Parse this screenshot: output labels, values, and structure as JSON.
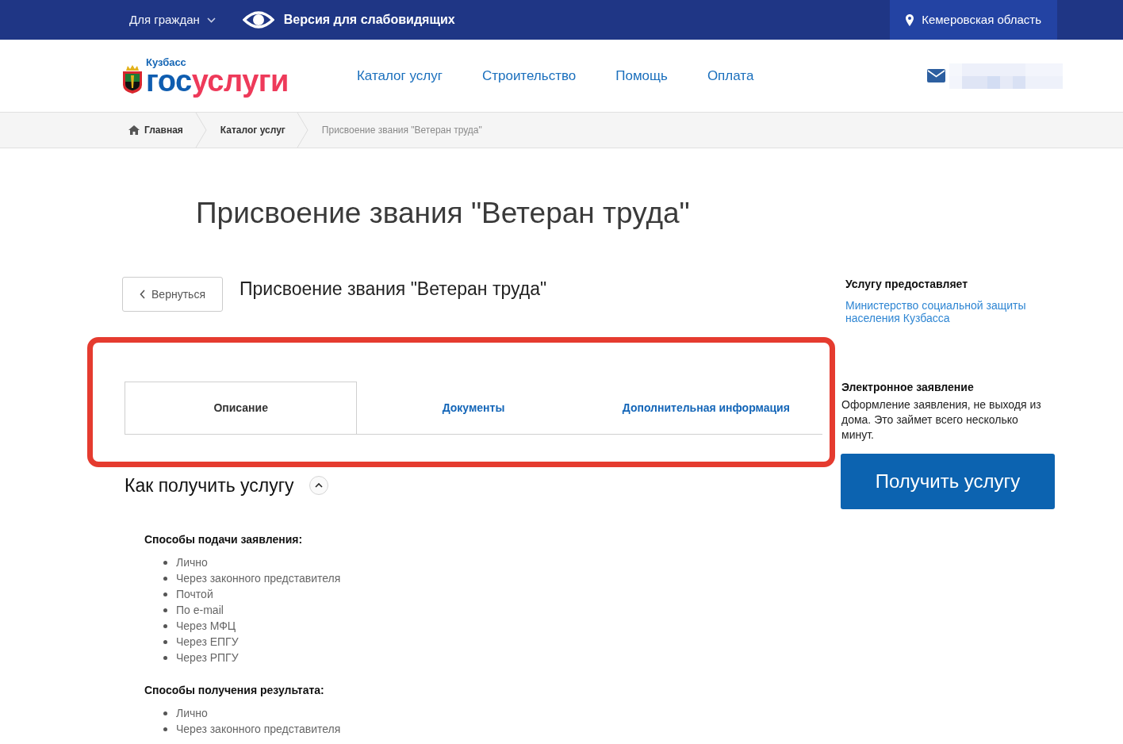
{
  "top_bar": {
    "audience_menu": "Для граждан",
    "accessibility_link": "Версия для слабовидящих",
    "region": "Кемеровская область"
  },
  "header": {
    "logo": {
      "caption": "Кузбасс",
      "wordmark_first": "гос",
      "wordmark_second": "услуги"
    },
    "nav": [
      "Каталог услуг",
      "Строительство",
      "Помощь",
      "Оплата"
    ]
  },
  "breadcrumbs": [
    {
      "label": "Главная",
      "kind": "home"
    },
    {
      "label": "Каталог услуг",
      "kind": "link"
    },
    {
      "label": "Присвоение звания \"Ветеран труда\"",
      "kind": "current"
    }
  ],
  "page_title": "Присвоение звания \"Ветеран труда\"",
  "service": {
    "back_button": "Вернуться",
    "title": "Присвоение звания \"Ветеран труда\""
  },
  "tab_bar": {
    "highlighted": true,
    "tabs": [
      {
        "label": "Описание",
        "selected": true
      },
      {
        "label": "Документы",
        "selected": false
      },
      {
        "label": "Дополнительная информация",
        "selected": false
      }
    ]
  },
  "section": {
    "title": "Как получить услугу",
    "expanded": true,
    "groups": [
      {
        "heading": "Способы подачи заявления:",
        "items": [
          "Лично",
          "Через законного представителя",
          "Почтой",
          "По e-mail",
          "Через МФЦ",
          "Через ЕПГУ",
          "Через РПГУ"
        ]
      },
      {
        "heading": "Способы получения результата:",
        "items": [
          "Лично",
          "Через законного представителя"
        ]
      }
    ]
  },
  "sidebar": {
    "provider_heading": "Услугу предоставляет",
    "provider_link": "Министерство социальной защиты населения Кузбасса",
    "application_heading": "Электронное заявление",
    "application_text": "Оформление заявления, не выходя из дома. Это займет всего несколько минут.",
    "cta_button": "Получить услугу"
  }
}
